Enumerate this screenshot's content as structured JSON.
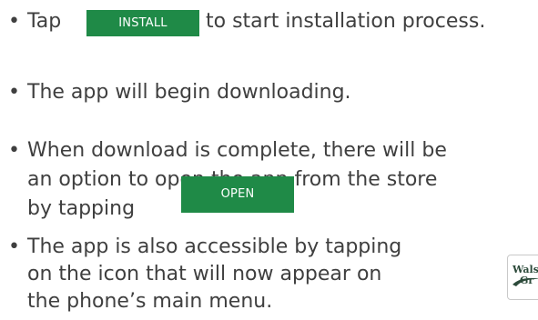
{
  "instructions": {
    "item1": {
      "pre": "Tap",
      "button": "INSTALL",
      "post": "to start installation process."
    },
    "item2": {
      "text": "The app will begin downloading."
    },
    "item3": {
      "line1": "When download is complete, there will be",
      "line2": "an option to open the app from the store",
      "line3": "by tapping",
      "button": "OPEN"
    },
    "item4": {
      "line1": "The app is also accessible by tapping",
      "line2": "on the icon that will now appear on",
      "line3": "the phone’s main menu."
    }
  },
  "app_icon": {
    "line1": "Wals",
    "line2": "Gr"
  },
  "bullet": "•",
  "colors": {
    "button_bg": "#1f8a47",
    "text": "#3f3f3f"
  }
}
